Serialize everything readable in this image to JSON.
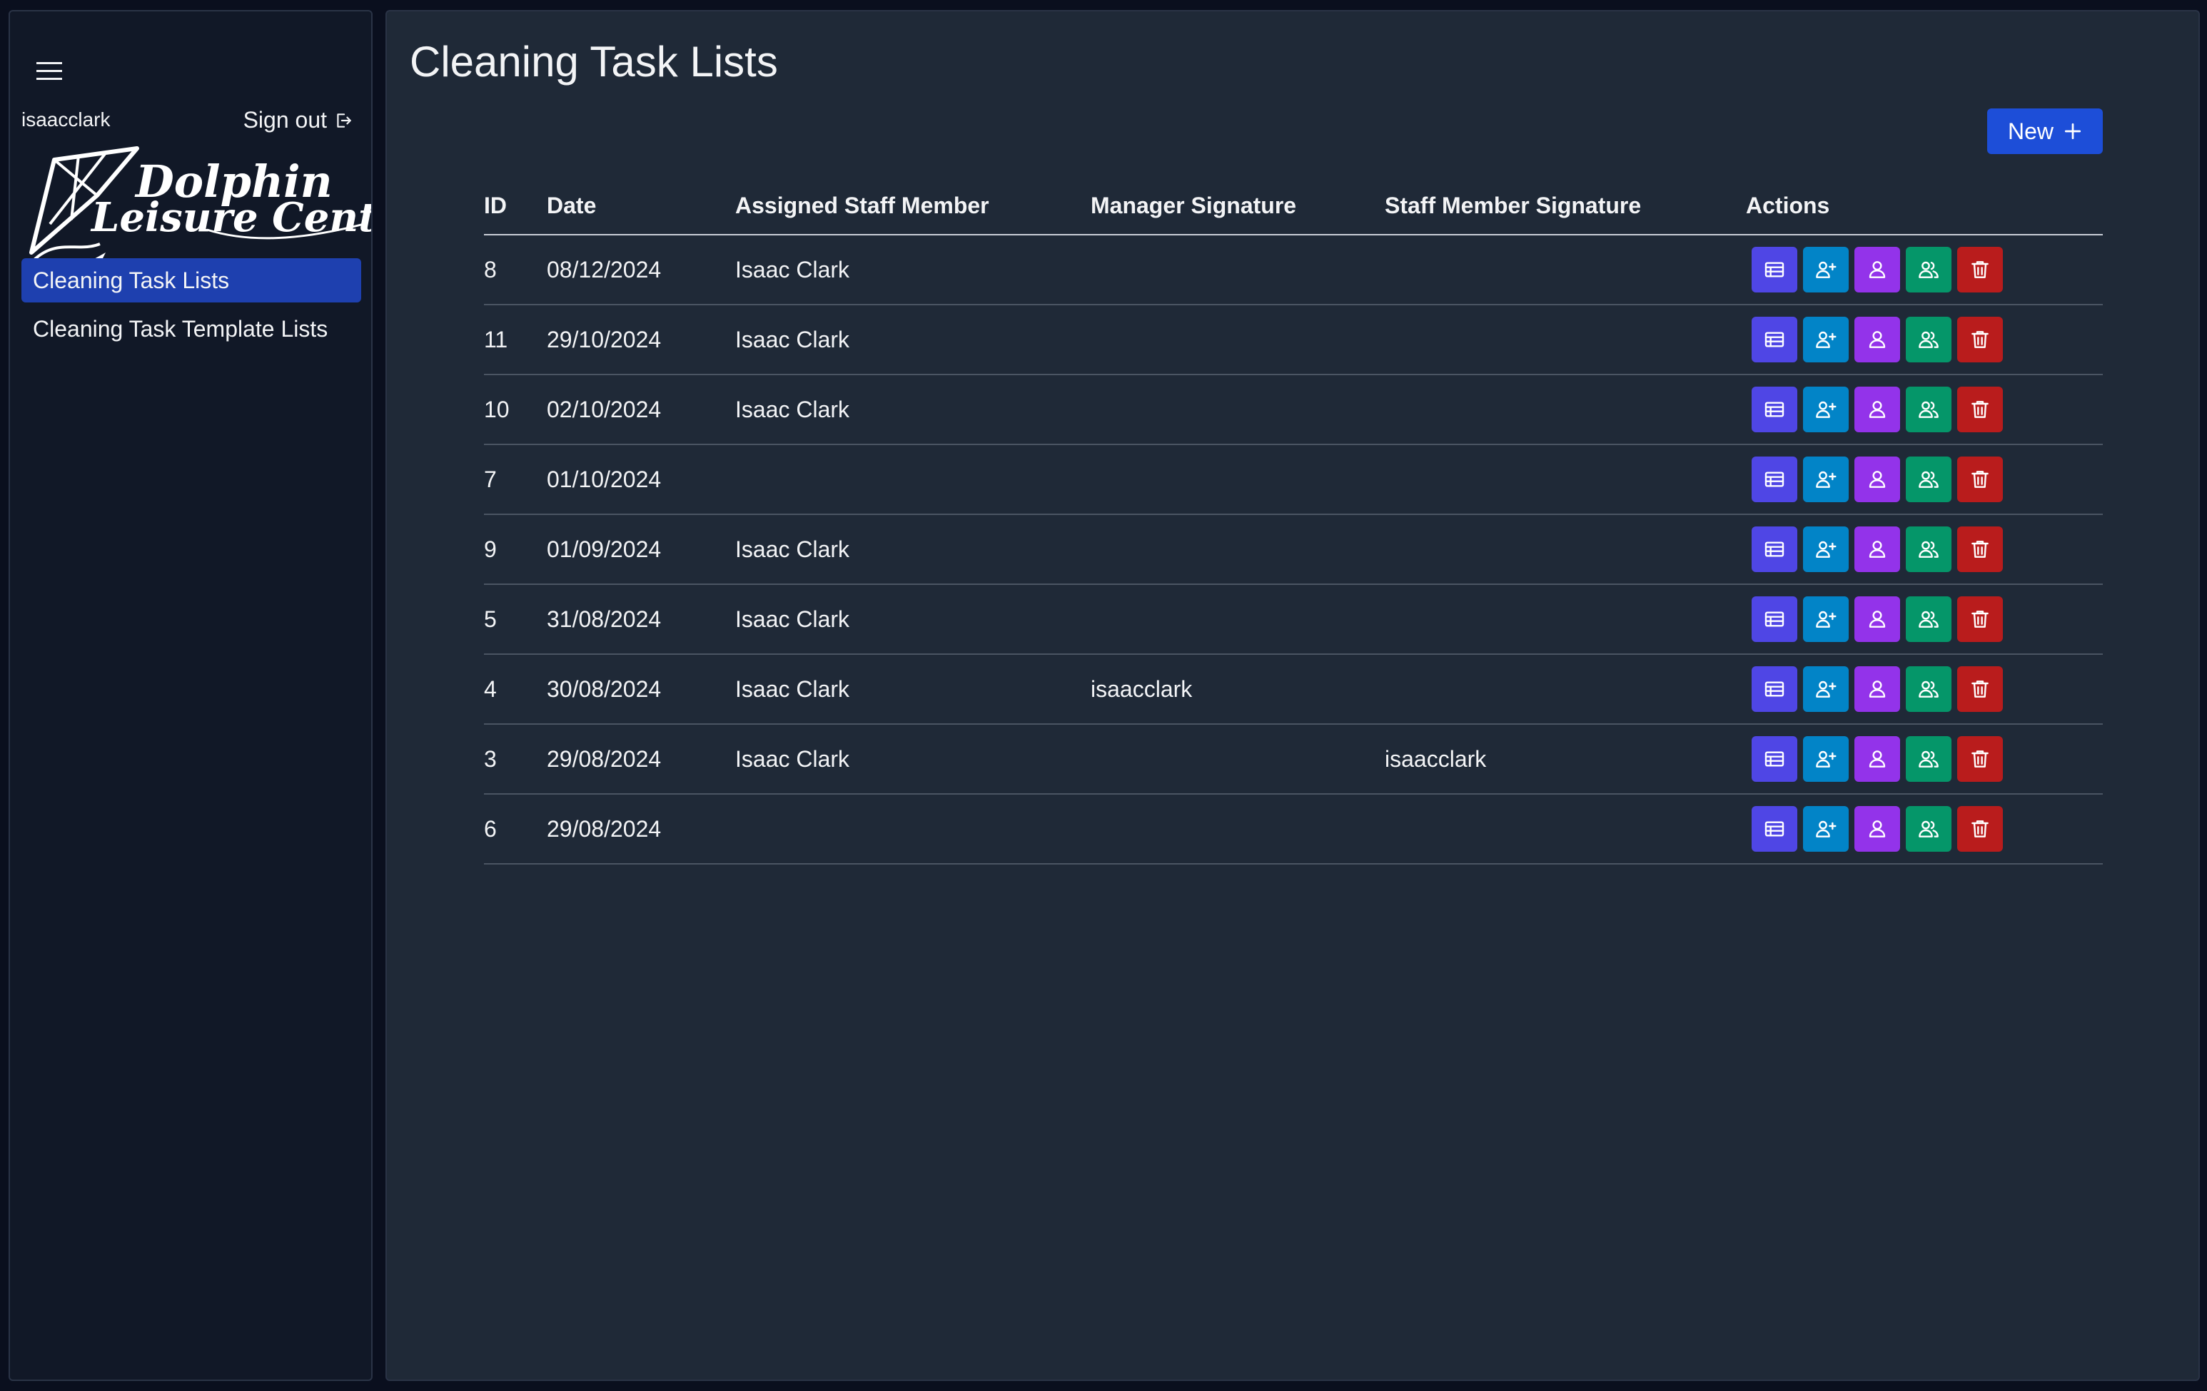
{
  "user": {
    "username": "isaacclark",
    "signout_label": "Sign out"
  },
  "icons": {
    "menu": "hamburger-menu-icon",
    "signout": "sign-out-icon",
    "plus": "plus-icon",
    "view": "table-list-icon",
    "assign": "user-plus-icon",
    "manager_sign": "user-icon",
    "staff_sign": "users-icon",
    "delete": "trash-icon"
  },
  "logo": {
    "line1": "Dolphin",
    "line2": "Leisure Centre"
  },
  "sidebar": {
    "items": [
      {
        "label": "Cleaning Task Lists",
        "active": true
      },
      {
        "label": "Cleaning Task Template Lists",
        "active": false
      }
    ]
  },
  "main": {
    "title": "Cleaning Task Lists",
    "new_label": "New"
  },
  "table": {
    "headers": {
      "id": "ID",
      "date": "Date",
      "staff": "Assigned Staff Member",
      "manager": "Manager Signature",
      "signature": "Staff Member Signature",
      "actions": "Actions"
    },
    "rows": [
      {
        "id": "8",
        "date": "08/12/2024",
        "staff": "Isaac Clark",
        "manager": "",
        "signature": ""
      },
      {
        "id": "11",
        "date": "29/10/2024",
        "staff": "Isaac Clark",
        "manager": "",
        "signature": ""
      },
      {
        "id": "10",
        "date": "02/10/2024",
        "staff": "Isaac Clark",
        "manager": "",
        "signature": ""
      },
      {
        "id": "7",
        "date": "01/10/2024",
        "staff": "",
        "manager": "",
        "signature": ""
      },
      {
        "id": "9",
        "date": "01/09/2024",
        "staff": "Isaac Clark",
        "manager": "",
        "signature": ""
      },
      {
        "id": "5",
        "date": "31/08/2024",
        "staff": "Isaac Clark",
        "manager": "",
        "signature": ""
      },
      {
        "id": "4",
        "date": "30/08/2024",
        "staff": "Isaac Clark",
        "manager": "isaacclark",
        "signature": ""
      },
      {
        "id": "3",
        "date": "29/08/2024",
        "staff": "Isaac Clark",
        "manager": "",
        "signature": "isaacclark"
      },
      {
        "id": "6",
        "date": "29/08/2024",
        "staff": "",
        "manager": "",
        "signature": ""
      }
    ]
  },
  "colors": {
    "view": "#4f46e5",
    "assign": "#0284c7",
    "manager_sign": "#9333ea",
    "staff_sign": "#059669",
    "delete": "#b91c1c",
    "primary": "#1d4ed8",
    "active_nav": "#1e40af"
  }
}
